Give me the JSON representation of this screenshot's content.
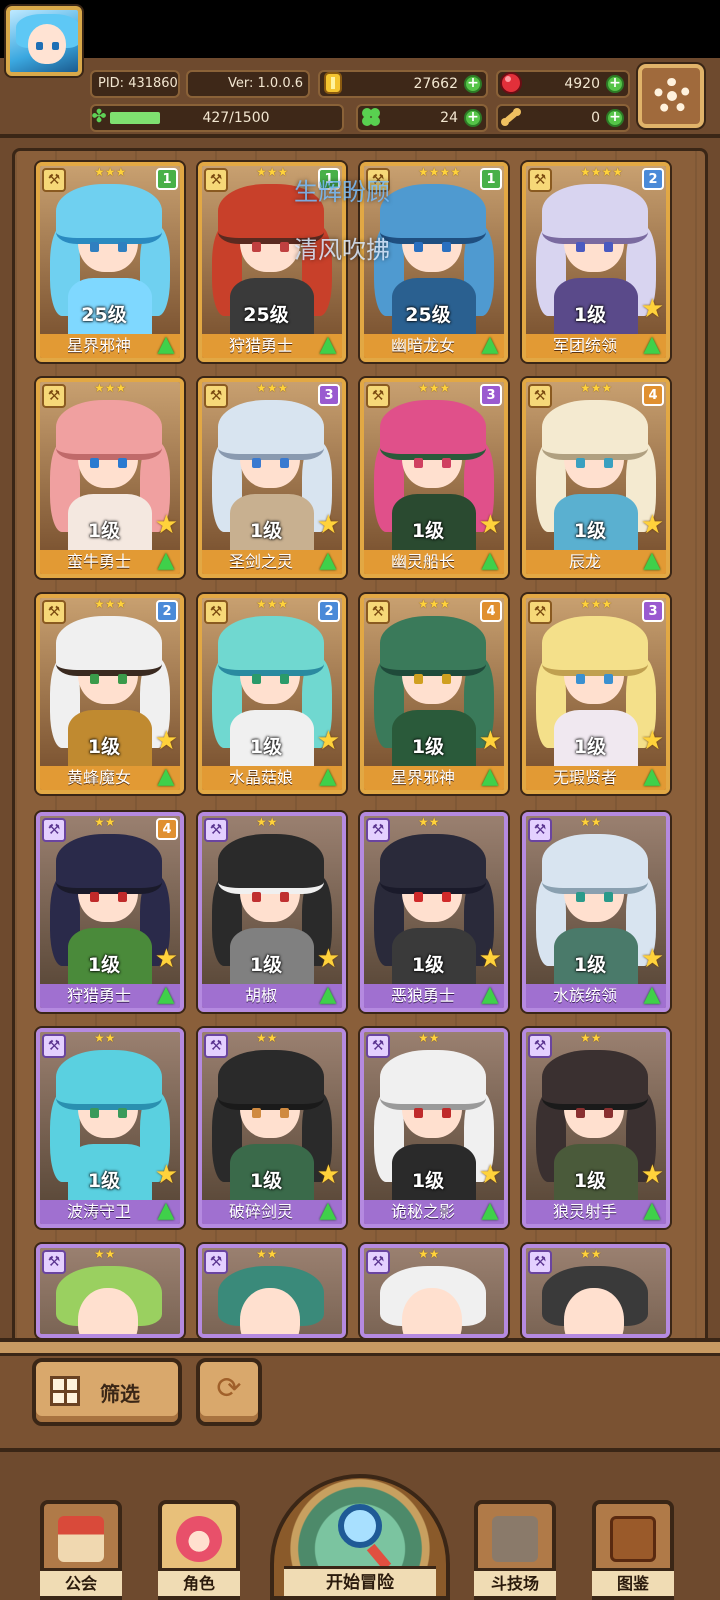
{
  "header": {
    "pid": "PID: 431860",
    "version": "Ver: 1.0.0.6",
    "exp": "427/1500",
    "exp_progress": 0.285,
    "gold": "27662",
    "gems": "4920",
    "clover": "24",
    "bone": "0"
  },
  "overlay": {
    "line1": "生辉盼顾",
    "line2": "清风吹拂"
  },
  "cards": [
    {
      "name": "星界邪神",
      "level": "25级",
      "tag": "1",
      "stars": "★★★"
    },
    {
      "name": "狩猎勇士",
      "level": "25级",
      "tag": "1",
      "stars": "★★★"
    },
    {
      "name": "幽暗龙女",
      "level": "25级",
      "tag": "1",
      "stars": "★★★★"
    },
    {
      "name": "军团统领",
      "level": "1级",
      "tag": "2",
      "stars": "★★★★"
    },
    {
      "name": "蛮牛勇士",
      "level": "1级",
      "tag": "",
      "stars": "★★★"
    },
    {
      "name": "圣剑之灵",
      "level": "1级",
      "tag": "3",
      "stars": "★★★"
    },
    {
      "name": "幽灵船长",
      "level": "1级",
      "tag": "3",
      "stars": "★★★"
    },
    {
      "name": "辰龙",
      "level": "1级",
      "tag": "4",
      "stars": "★★★"
    },
    {
      "name": "黄蜂魔女",
      "level": "1级",
      "tag": "2",
      "stars": "★★★"
    },
    {
      "name": "水晶菇娘",
      "level": "1级",
      "tag": "2",
      "stars": "★★★"
    },
    {
      "name": "星界邪神",
      "level": "1级",
      "tag": "4",
      "stars": "★★★"
    },
    {
      "name": "无瑕贤者",
      "level": "1级",
      "tag": "3",
      "stars": "★★★"
    },
    {
      "name": "狩猎勇士",
      "level": "1级",
      "tag": "4",
      "stars": "★★"
    },
    {
      "name": "胡椒",
      "level": "1级",
      "tag": "",
      "stars": "★★"
    },
    {
      "name": "恶狼勇士",
      "level": "1级",
      "tag": "",
      "stars": "★★"
    },
    {
      "name": "水族统领",
      "level": "1级",
      "tag": "",
      "stars": "★★"
    },
    {
      "name": "波涛守卫",
      "level": "1级",
      "tag": "",
      "stars": "★★"
    },
    {
      "name": "破碎剑灵",
      "level": "1级",
      "tag": "",
      "stars": "★★"
    },
    {
      "name": "诡秘之影",
      "level": "1级",
      "tag": "",
      "stars": "★★"
    },
    {
      "name": "狼灵射手",
      "level": "1级",
      "tag": "",
      "stars": "★★"
    }
  ],
  "partial_cards": [
    {
      "stars": "★★"
    },
    {
      "stars": "★★"
    },
    {
      "stars": "★★"
    },
    {
      "stars": "★★"
    }
  ],
  "controls": {
    "filter": "筛选"
  },
  "nav": {
    "guild": "公会",
    "character": "角色",
    "adventure": "开始冒险",
    "arena": "斗技场",
    "codex": "图鉴"
  }
}
